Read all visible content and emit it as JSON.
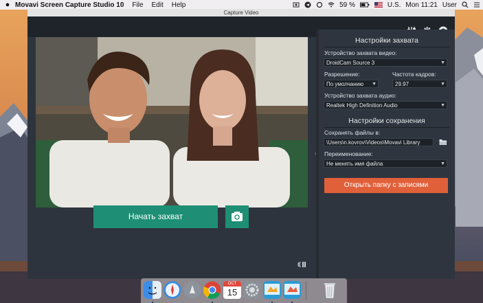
{
  "menubar": {
    "app_name": "Movavi Screen Capture Studio 10",
    "items": [
      "File",
      "Edit",
      "Help"
    ],
    "battery": "59 %",
    "input_source": "U.S.",
    "clock": "Mon 11:21",
    "user": "User"
  },
  "window": {
    "title": "Capture Video"
  },
  "capture_settings": {
    "title": "Настройки захвата",
    "video_device_label": "Устройство захвата видео:",
    "video_device_value": "DroidCam Source 3",
    "resolution_label": "Разрешение:",
    "resolution_value": "По умолчанию",
    "framerate_label": "Частота кадров:",
    "framerate_value": "29.97",
    "audio_device_label": "Устройство захвата аудио:",
    "audio_device_value": "Realtek High Definition Audio"
  },
  "save_settings": {
    "title": "Настройки сохранения",
    "save_to_label": "Сохранять файлы в:",
    "save_to_value": "\\Users\\n.kovrov\\Videos\\Movavi Library",
    "rename_label": "Переименование:",
    "rename_value": "Не менять имя файла",
    "open_folder_button": "Открыть папку с записями"
  },
  "controls": {
    "start_button": "Начать захват"
  },
  "dock": {
    "calendar_month": "OCT",
    "calendar_day": "15"
  },
  "colors": {
    "accent_green": "#1e8f74",
    "accent_orange": "#e0603a"
  }
}
